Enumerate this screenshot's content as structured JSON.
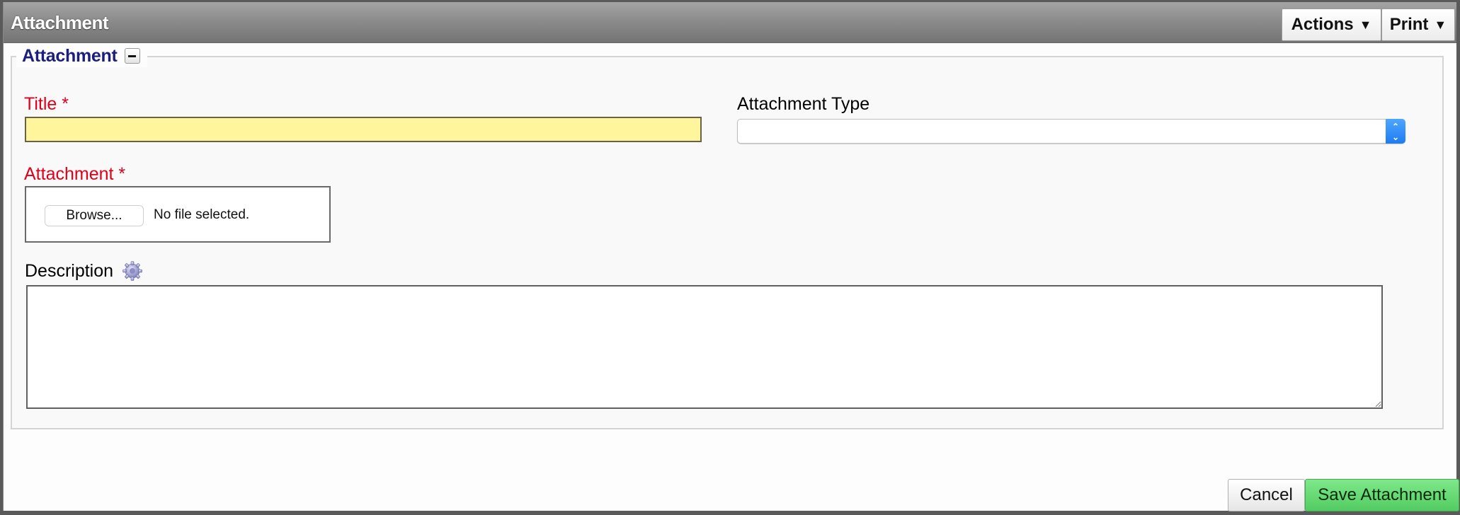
{
  "window": {
    "title": "Attachment"
  },
  "toolbar": {
    "actions_label": "Actions",
    "print_label": "Print",
    "caret": "▼"
  },
  "section": {
    "legend": "Attachment",
    "collapse_icon": "minus-icon"
  },
  "form": {
    "title": {
      "label": "Title *",
      "value": "",
      "required": true,
      "highlight_color": "#fff59d"
    },
    "attachment_type": {
      "label": "Attachment Type",
      "selected": ""
    },
    "attachment": {
      "label": "Attachment *",
      "required": true,
      "browse_label": "Browse...",
      "status": "No file selected."
    },
    "description": {
      "label": "Description",
      "value": "",
      "icon": "gear-icon"
    }
  },
  "footer": {
    "cancel_label": "Cancel",
    "save_label": "Save Attachment",
    "save_color": "#5fd96e"
  },
  "colors": {
    "required_label": "#e0001b",
    "legend_text": "#1a1f7c"
  }
}
